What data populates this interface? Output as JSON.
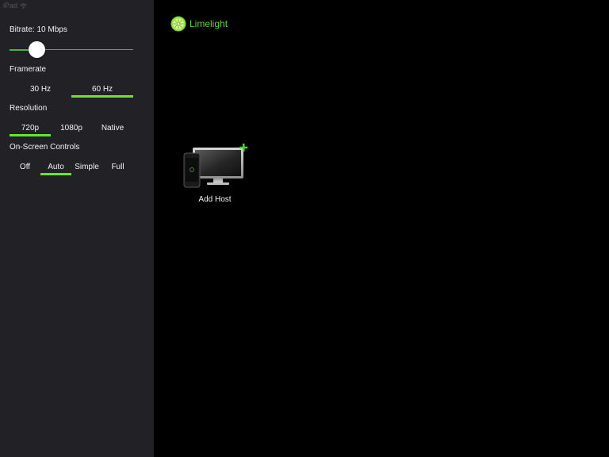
{
  "status_bar": {
    "device": "iPad"
  },
  "sidebar": {
    "bitrate": {
      "label": "Bitrate: 10 Mbps",
      "slider_fraction": 0.22
    },
    "framerate": {
      "label": "Framerate",
      "options": [
        "30 Hz",
        "60 Hz"
      ],
      "selected": "60 Hz"
    },
    "resolution": {
      "label": "Resolution",
      "options": [
        "720p",
        "1080p",
        "Native"
      ],
      "selected": "720p"
    },
    "onscreen_controls": {
      "label": "On-Screen Controls",
      "options": [
        "Off",
        "Auto",
        "Simple",
        "Full"
      ],
      "selected": "Auto"
    }
  },
  "main": {
    "logo_text": "Limelight",
    "add_host_label": "Add Host",
    "add_host_icon": "monitor-with-plus-icon"
  },
  "colors": {
    "accent": "#6ae23a",
    "logo": "#5fd335",
    "sidebar_bg": "#222226",
    "main_bg": "#000000"
  }
}
